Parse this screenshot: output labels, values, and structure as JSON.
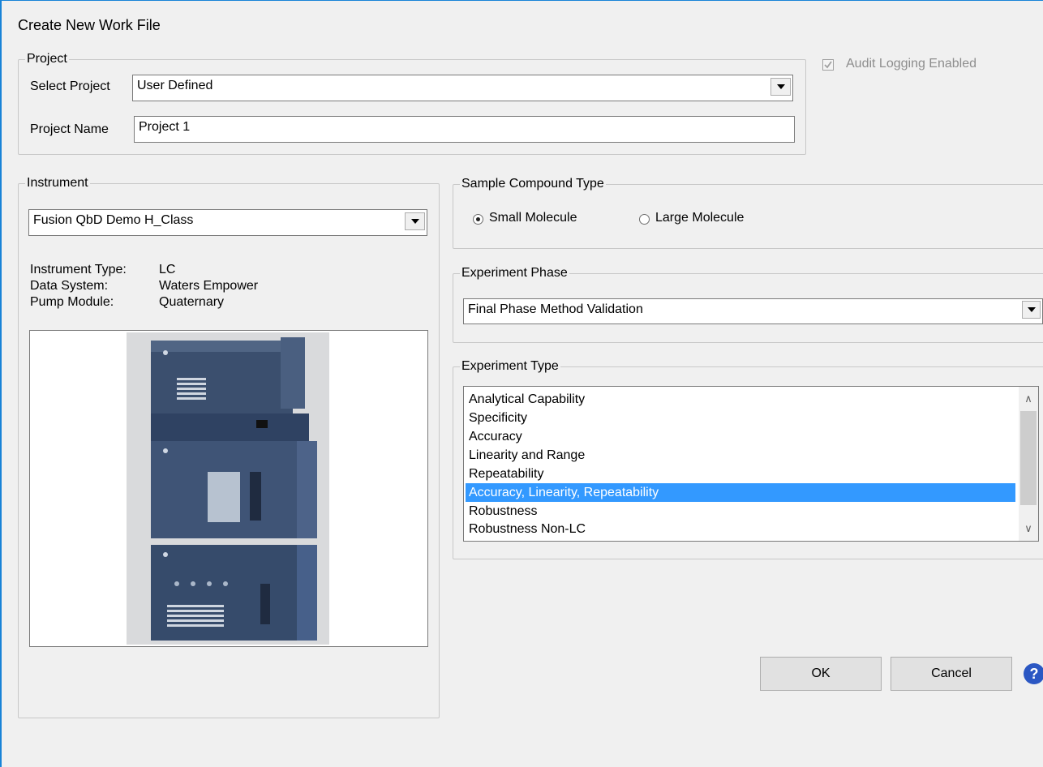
{
  "window": {
    "title": "Create New Work File"
  },
  "audit": {
    "label": "Audit Logging Enabled",
    "checked": true,
    "enabled": false
  },
  "project": {
    "legend": "Project",
    "select_label": "Select Project",
    "select_value": "User Defined",
    "name_label": "Project Name",
    "name_value": "Project 1"
  },
  "instrument": {
    "legend": "Instrument",
    "selected": "Fusion QbD Demo H_Class",
    "type_label": "Instrument Type:",
    "type_value": "LC",
    "system_label": "Data System:",
    "system_value": "Waters Empower",
    "pump_label": "Pump Module:",
    "pump_value": "Quaternary"
  },
  "compound": {
    "legend": "Sample Compound Type",
    "options": [
      "Small Molecule",
      "Large Molecule"
    ],
    "selected": "Small Molecule"
  },
  "phase": {
    "legend": "Experiment Phase",
    "selected": "Final Phase Method Validation"
  },
  "experiment_type": {
    "legend": "Experiment Type",
    "items": [
      "Analytical Capability",
      "Specificity",
      "Accuracy",
      "Linearity and Range",
      "Repeatability",
      "Accuracy, Linearity, Repeatability",
      "Robustness",
      "Robustness Non-LC"
    ],
    "selected": "Accuracy, Linearity, Repeatability"
  },
  "buttons": {
    "ok": "OK",
    "cancel": "Cancel",
    "help": "?"
  },
  "colors": {
    "selection": "#3399ff",
    "window_border": "#1883d7",
    "instrument_body": "#3b4f6e"
  }
}
